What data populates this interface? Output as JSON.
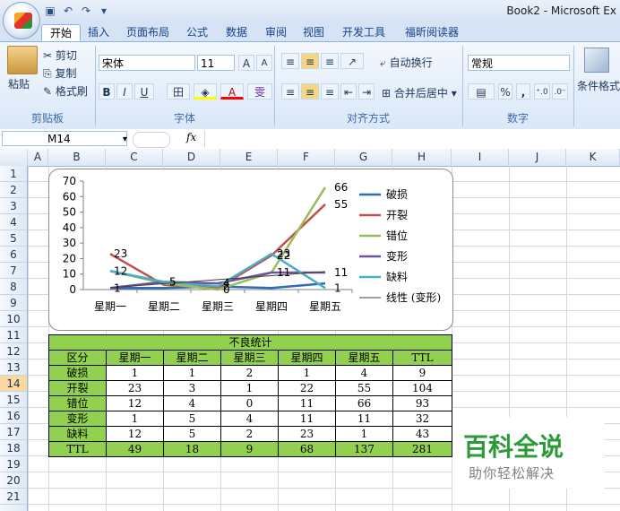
{
  "window": {
    "title": "Book2 - Microsoft Ex"
  },
  "tabs": [
    "开始",
    "插入",
    "页面布局",
    "公式",
    "数据",
    "审阅",
    "视图",
    "开发工具",
    "福昕阅读器"
  ],
  "ribbon": {
    "clipboard": {
      "label": "剪贴板",
      "paste": "粘贴",
      "cut": "剪切",
      "copy": "复制",
      "format_painter": "格式刷"
    },
    "font": {
      "label": "字体",
      "name": "宋体",
      "size": "11",
      "bold": "B",
      "italic": "I",
      "underline": "U",
      "wen": "雯"
    },
    "alignment": {
      "label": "对齐方式",
      "wrap": "自动换行",
      "merge": "合并后居中"
    },
    "number": {
      "label": "数字",
      "format": "常规",
      "percent": "%",
      "comma": ","
    },
    "styles": {
      "conditional": "条件格式"
    }
  },
  "formula_bar": {
    "cell_ref": "M14",
    "fx": "fx"
  },
  "columns": [
    "A",
    "B",
    "C",
    "D",
    "E",
    "F",
    "G",
    "H",
    "I",
    "J",
    "K"
  ],
  "rows": [
    "1",
    "2",
    "3",
    "4",
    "5",
    "6",
    "7",
    "8",
    "9",
    "10",
    "11",
    "12",
    "13",
    "14",
    "15",
    "16",
    "17",
    "18",
    "19",
    "20",
    "21"
  ],
  "selected_row": "14",
  "table": {
    "title": "不良统计",
    "header": [
      "区分",
      "星期一",
      "星期二",
      "星期三",
      "星期四",
      "星期五",
      "TTL"
    ],
    "rows": [
      [
        "破损",
        "1",
        "1",
        "2",
        "1",
        "4",
        "9"
      ],
      [
        "开裂",
        "23",
        "3",
        "1",
        "22",
        "55",
        "104"
      ],
      [
        "错位",
        "12",
        "4",
        "0",
        "11",
        "66",
        "93"
      ],
      [
        "变形",
        "1",
        "5",
        "4",
        "11",
        "11",
        "32"
      ],
      [
        "缺料",
        "12",
        "5",
        "2",
        "23",
        "1",
        "43"
      ],
      [
        "TTL",
        "49",
        "18",
        "9",
        "68",
        "137",
        "281"
      ]
    ]
  },
  "chart_data": {
    "type": "line",
    "categories": [
      "星期一",
      "星期二",
      "星期三",
      "星期四",
      "星期五"
    ],
    "ylim": [
      0,
      70
    ],
    "yticks": [
      0,
      10,
      20,
      30,
      40,
      50,
      60,
      70
    ],
    "legend_position": "right",
    "series": [
      {
        "name": "破损",
        "values": [
          1,
          1,
          2,
          1,
          4
        ],
        "color": "#2e6db4"
      },
      {
        "name": "开裂",
        "values": [
          23,
          3,
          1,
          22,
          55
        ],
        "color": "#c0504d"
      },
      {
        "name": "错位",
        "values": [
          12,
          4,
          0,
          11,
          66
        ],
        "color": "#9bbb59"
      },
      {
        "name": "变形",
        "values": [
          1,
          5,
          4,
          11,
          11
        ],
        "color": "#7052a0"
      },
      {
        "name": "缺料",
        "values": [
          12,
          5,
          2,
          23,
          1
        ],
        "color": "#4bacc6"
      }
    ],
    "trendline": {
      "name": "线性 (变形)",
      "color": "#404040"
    },
    "data_labels": [
      {
        "series": "开裂",
        "index": 0,
        "text": "23"
      },
      {
        "series": "错位",
        "index": 0,
        "text": "12"
      },
      {
        "series": "变形",
        "index": 0,
        "text": "1"
      },
      {
        "series": "变形",
        "index": 1,
        "text": "5"
      },
      {
        "series": "缺料",
        "index": 1,
        "text": "5"
      },
      {
        "series": "变形",
        "index": 2,
        "text": "4"
      },
      {
        "series": "缺料",
        "index": 2,
        "text": "2"
      },
      {
        "series": "错位",
        "index": 2,
        "text": "0"
      },
      {
        "series": "缺料",
        "index": 3,
        "text": "23"
      },
      {
        "series": "开裂",
        "index": 3,
        "text": "22"
      },
      {
        "series": "变形",
        "index": 3,
        "text": "11"
      },
      {
        "series": "错位",
        "index": 4,
        "text": "66"
      },
      {
        "series": "开裂",
        "index": 4,
        "text": "55"
      },
      {
        "series": "变形",
        "index": 4,
        "text": "11"
      },
      {
        "series": "缺料",
        "index": 4,
        "text": "1"
      }
    ]
  },
  "watermark": {
    "main": "百科全说",
    "sub": "助你轻松解决"
  },
  "colors": {
    "table_green": "#92d050",
    "ribbon_blue": "#d6e3f4"
  }
}
